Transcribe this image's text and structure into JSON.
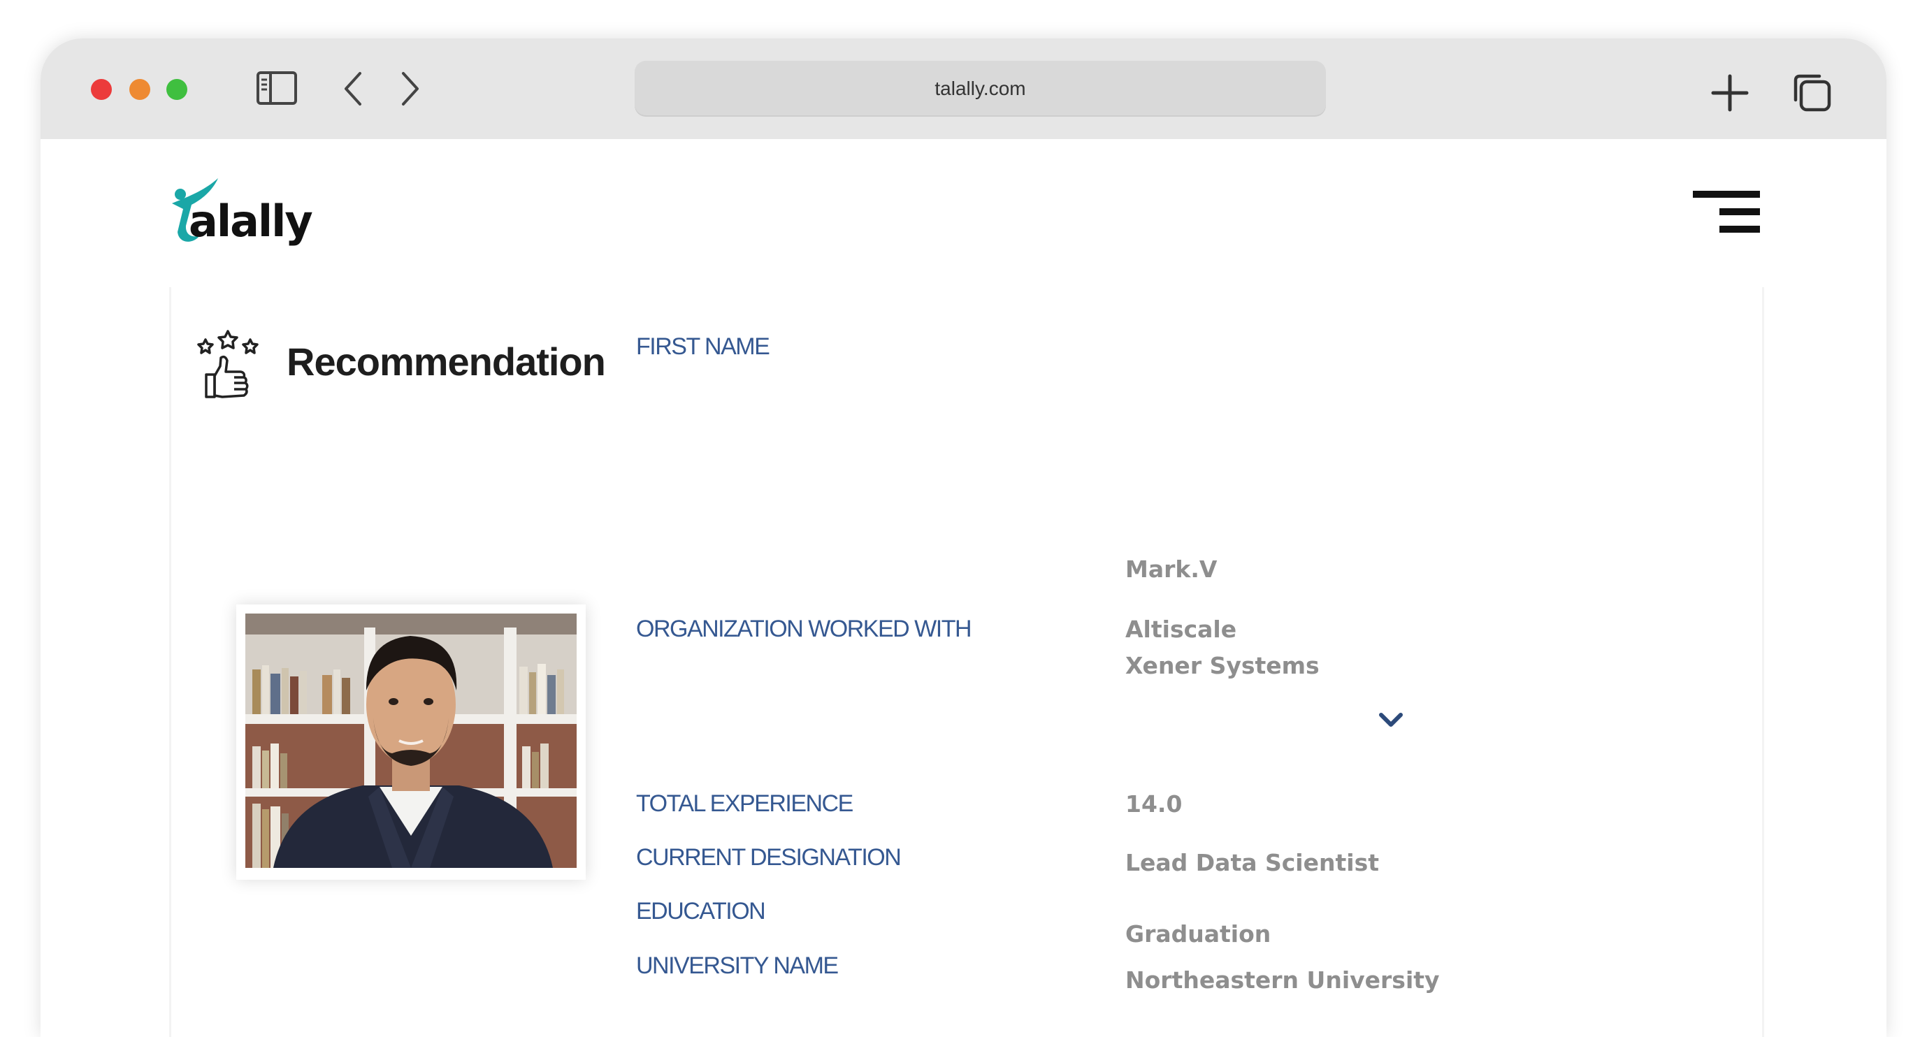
{
  "browser": {
    "url": "talally.com",
    "controls": {
      "sidebar_icon": "sidebar-icon",
      "back_icon": "chevron-left-icon",
      "forward_icon": "chevron-right-icon",
      "new_tab_icon": "plus-icon",
      "tabs_icon": "tabs-overview-icon"
    }
  },
  "header": {
    "logo_text": "alally",
    "menu_icon": "hamburger-menu-icon"
  },
  "section": {
    "title": "Recommendation",
    "icon": "stars-thumbs-up-icon"
  },
  "profile": {
    "photo_icon": "profile-photo",
    "fields": [
      {
        "label": "FIRST NAME",
        "value": "Mark.V"
      },
      {
        "label": "ORGANIZATION WORKED WITH",
        "values": [
          "Altiscale",
          "Xener Systems"
        ]
      },
      {
        "label": "TOTAL EXPERIENCE",
        "value": "14.0"
      },
      {
        "label": "CURRENT DESIGNATION",
        "value": "Lead Data Scientist"
      },
      {
        "label": "EDUCATION",
        "value": "Graduation"
      },
      {
        "label": "UNIVERSITY NAME",
        "value": "Northeastern University"
      }
    ],
    "expand_icon": "chevron-down-icon"
  },
  "colors": {
    "label_blue": "#355891",
    "value_gray": "#8e8e8e",
    "brand_teal": "#1aa7a7",
    "chrome_gray": "#e6e6e6"
  }
}
